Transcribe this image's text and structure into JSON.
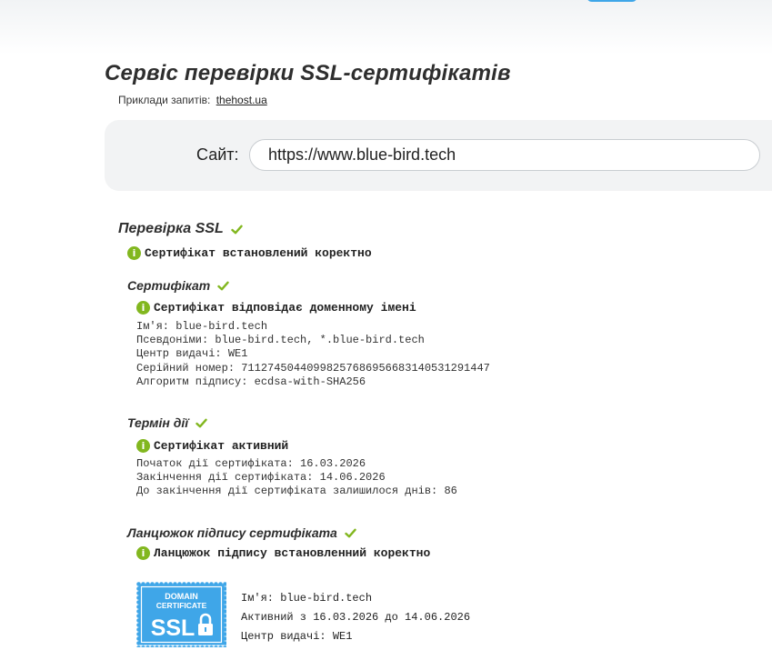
{
  "header": {
    "title": "Сервіс перевірки SSL-сертифікатів",
    "examples_label": "Приклади запитів:",
    "examples_link": "thehost.ua"
  },
  "search": {
    "label": "Сайт:",
    "value": "https://www.blue-bird.tech"
  },
  "ssl_check": {
    "title": "Перевірка SSL",
    "status": "Сертифікат встановлений коректно"
  },
  "certificate": {
    "title": "Сертифікат",
    "status": "Сертифікат відповідає доменному імені",
    "lines": [
      "Ім'я: blue-bird.tech",
      "Псевдоніми: blue-bird.tech, *.blue-bird.tech",
      "Центр видачі: WE1",
      "Серійний номер: 71127450440998257686956683140531291447",
      "Алгоритм підпису: ecdsa-with-SHA256"
    ]
  },
  "validity": {
    "title": "Термін дії",
    "status": "Сертифікат активний",
    "lines": [
      "Початок дії сертифіката: 16.03.2026",
      "Закінчення дії сертифіката: 14.06.2026",
      "До закінчення дії сертифіката залишилося днів: 86"
    ]
  },
  "chain": {
    "title": "Ланцюжок підпису сертифіката",
    "status": "Ланцюжок підпису встановленний коректно",
    "badge": {
      "line1": "DOMAIN",
      "line2": "CERTIFICATE",
      "line3": "SSL"
    },
    "entries": [
      "Ім'я: blue-bird.tech",
      "Активний з 16.03.2026 до 14.06.2026",
      "Центр видачі: WE1"
    ]
  },
  "colors": {
    "check_green": "#82b71f",
    "badge_blue": "#3fa6e8"
  }
}
